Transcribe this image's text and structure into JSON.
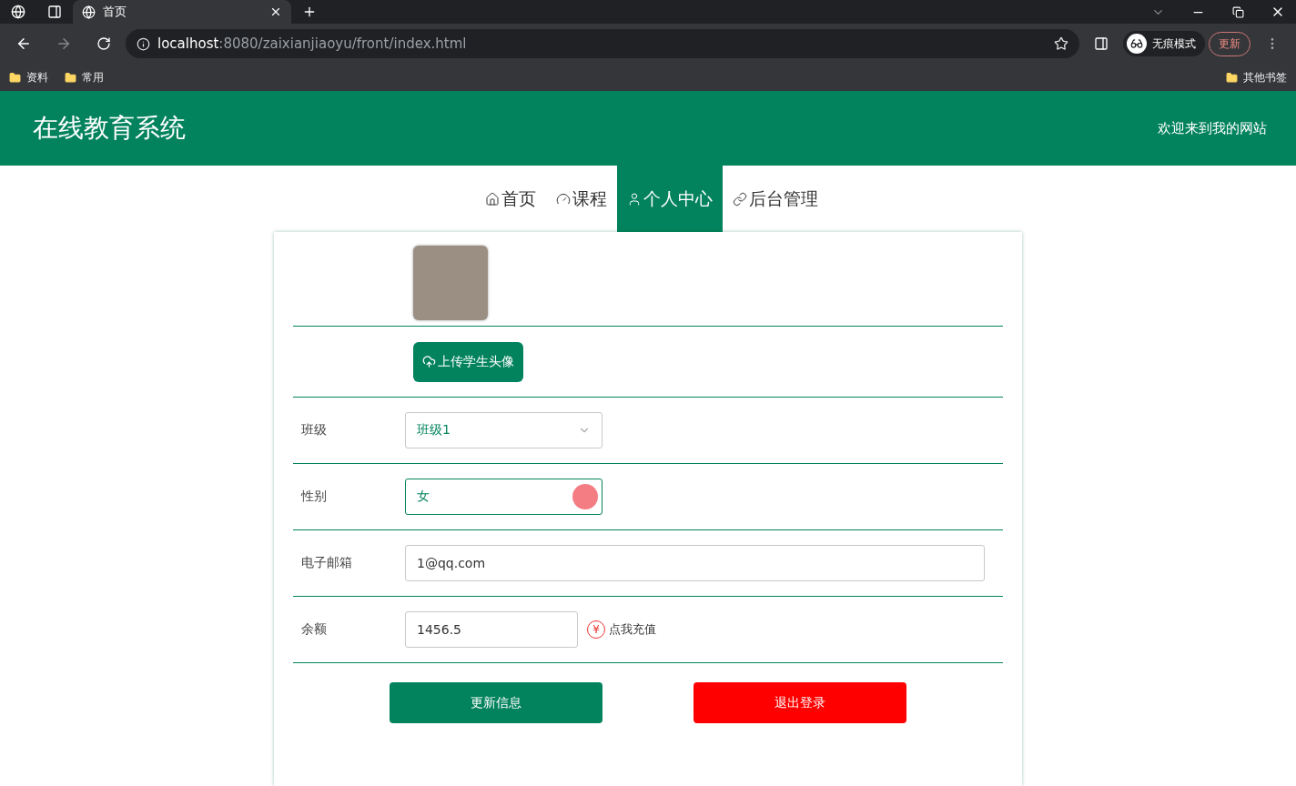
{
  "browser": {
    "tabs": [
      {
        "title": "首页",
        "selected": true
      }
    ],
    "address": {
      "host": "localhost",
      "path": ":8080/zaixianjiaoyu/front/index.html"
    },
    "incognito_label": "无痕模式",
    "update_button": "更新",
    "bookmarks": [
      "资料",
      "常用"
    ],
    "other_bookmarks": "其他书签"
  },
  "site": {
    "title": "在线教育系统",
    "welcome": "欢迎来到我的网站",
    "nav": [
      {
        "label": "首页",
        "selected": false
      },
      {
        "label": "课程",
        "selected": false
      },
      {
        "label": "个人中心",
        "selected": true
      },
      {
        "label": "后台管理",
        "selected": false
      }
    ]
  },
  "form": {
    "upload_button": "上传学生头像",
    "fields": [
      {
        "kind": "select",
        "label": "班级",
        "value": "班级1",
        "focused": false
      },
      {
        "kind": "select",
        "label": "性别",
        "value": "女",
        "focused": true
      },
      {
        "kind": "input",
        "label": "电子邮箱",
        "value": "1@qq.com",
        "focused": false
      },
      {
        "kind": "input",
        "label": "余额",
        "value": "1456.5",
        "focused": false,
        "recharge": {
          "icon": "¥",
          "label": "点我充值"
        }
      }
    ],
    "buttons": [
      {
        "label": "更新信息",
        "kind": "primary"
      },
      {
        "label": "退出登录",
        "kind": "danger"
      }
    ]
  }
}
